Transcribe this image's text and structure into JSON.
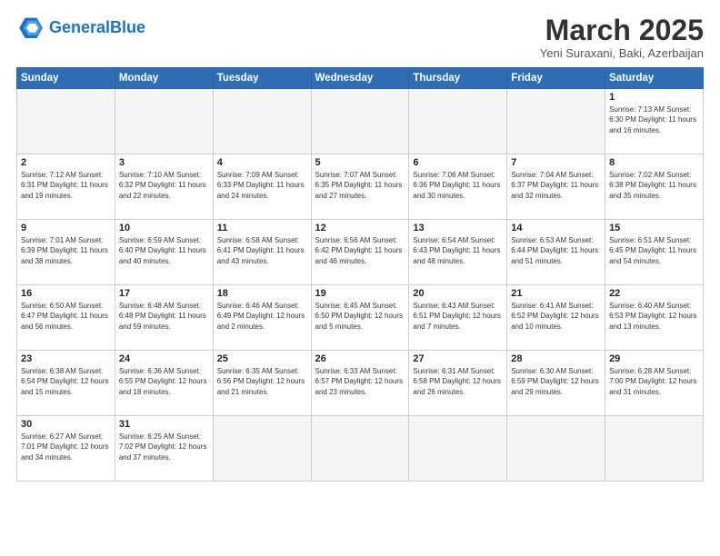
{
  "logo": {
    "text_general": "General",
    "text_blue": "Blue"
  },
  "title": "March 2025",
  "location": "Yeni Suraxani, Baki, Azerbaijan",
  "days_of_week": [
    "Sunday",
    "Monday",
    "Tuesday",
    "Wednesday",
    "Thursday",
    "Friday",
    "Saturday"
  ],
  "weeks": [
    [
      {
        "day": "",
        "info": ""
      },
      {
        "day": "",
        "info": ""
      },
      {
        "day": "",
        "info": ""
      },
      {
        "day": "",
        "info": ""
      },
      {
        "day": "",
        "info": ""
      },
      {
        "day": "",
        "info": ""
      },
      {
        "day": "1",
        "info": "Sunrise: 7:13 AM\nSunset: 6:30 PM\nDaylight: 11 hours and 16 minutes."
      }
    ],
    [
      {
        "day": "2",
        "info": "Sunrise: 7:12 AM\nSunset: 6:31 PM\nDaylight: 11 hours and 19 minutes."
      },
      {
        "day": "3",
        "info": "Sunrise: 7:10 AM\nSunset: 6:32 PM\nDaylight: 11 hours and 22 minutes."
      },
      {
        "day": "4",
        "info": "Sunrise: 7:09 AM\nSunset: 6:33 PM\nDaylight: 11 hours and 24 minutes."
      },
      {
        "day": "5",
        "info": "Sunrise: 7:07 AM\nSunset: 6:35 PM\nDaylight: 11 hours and 27 minutes."
      },
      {
        "day": "6",
        "info": "Sunrise: 7:06 AM\nSunset: 6:36 PM\nDaylight: 11 hours and 30 minutes."
      },
      {
        "day": "7",
        "info": "Sunrise: 7:04 AM\nSunset: 6:37 PM\nDaylight: 11 hours and 32 minutes."
      },
      {
        "day": "8",
        "info": "Sunrise: 7:02 AM\nSunset: 6:38 PM\nDaylight: 11 hours and 35 minutes."
      }
    ],
    [
      {
        "day": "9",
        "info": "Sunrise: 7:01 AM\nSunset: 6:39 PM\nDaylight: 11 hours and 38 minutes."
      },
      {
        "day": "10",
        "info": "Sunrise: 6:59 AM\nSunset: 6:40 PM\nDaylight: 11 hours and 40 minutes."
      },
      {
        "day": "11",
        "info": "Sunrise: 6:58 AM\nSunset: 6:41 PM\nDaylight: 11 hours and 43 minutes."
      },
      {
        "day": "12",
        "info": "Sunrise: 6:56 AM\nSunset: 6:42 PM\nDaylight: 11 hours and 46 minutes."
      },
      {
        "day": "13",
        "info": "Sunrise: 6:54 AM\nSunset: 6:43 PM\nDaylight: 11 hours and 48 minutes."
      },
      {
        "day": "14",
        "info": "Sunrise: 6:53 AM\nSunset: 6:44 PM\nDaylight: 11 hours and 51 minutes."
      },
      {
        "day": "15",
        "info": "Sunrise: 6:51 AM\nSunset: 6:45 PM\nDaylight: 11 hours and 54 minutes."
      }
    ],
    [
      {
        "day": "16",
        "info": "Sunrise: 6:50 AM\nSunset: 6:47 PM\nDaylight: 11 hours and 56 minutes."
      },
      {
        "day": "17",
        "info": "Sunrise: 6:48 AM\nSunset: 6:48 PM\nDaylight: 11 hours and 59 minutes."
      },
      {
        "day": "18",
        "info": "Sunrise: 6:46 AM\nSunset: 6:49 PM\nDaylight: 12 hours and 2 minutes."
      },
      {
        "day": "19",
        "info": "Sunrise: 6:45 AM\nSunset: 6:50 PM\nDaylight: 12 hours and 5 minutes."
      },
      {
        "day": "20",
        "info": "Sunrise: 6:43 AM\nSunset: 6:51 PM\nDaylight: 12 hours and 7 minutes."
      },
      {
        "day": "21",
        "info": "Sunrise: 6:41 AM\nSunset: 6:52 PM\nDaylight: 12 hours and 10 minutes."
      },
      {
        "day": "22",
        "info": "Sunrise: 6:40 AM\nSunset: 6:53 PM\nDaylight: 12 hours and 13 minutes."
      }
    ],
    [
      {
        "day": "23",
        "info": "Sunrise: 6:38 AM\nSunset: 6:54 PM\nDaylight: 12 hours and 15 minutes."
      },
      {
        "day": "24",
        "info": "Sunrise: 6:36 AM\nSunset: 6:55 PM\nDaylight: 12 hours and 18 minutes."
      },
      {
        "day": "25",
        "info": "Sunrise: 6:35 AM\nSunset: 6:56 PM\nDaylight: 12 hours and 21 minutes."
      },
      {
        "day": "26",
        "info": "Sunrise: 6:33 AM\nSunset: 6:57 PM\nDaylight: 12 hours and 23 minutes."
      },
      {
        "day": "27",
        "info": "Sunrise: 6:31 AM\nSunset: 6:58 PM\nDaylight: 12 hours and 26 minutes."
      },
      {
        "day": "28",
        "info": "Sunrise: 6:30 AM\nSunset: 6:59 PM\nDaylight: 12 hours and 29 minutes."
      },
      {
        "day": "29",
        "info": "Sunrise: 6:28 AM\nSunset: 7:00 PM\nDaylight: 12 hours and 31 minutes."
      }
    ],
    [
      {
        "day": "30",
        "info": "Sunrise: 6:27 AM\nSunset: 7:01 PM\nDaylight: 12 hours and 34 minutes."
      },
      {
        "day": "31",
        "info": "Sunrise: 6:25 AM\nSunset: 7:02 PM\nDaylight: 12 hours and 37 minutes."
      },
      {
        "day": "",
        "info": ""
      },
      {
        "day": "",
        "info": ""
      },
      {
        "day": "",
        "info": ""
      },
      {
        "day": "",
        "info": ""
      },
      {
        "day": "",
        "info": ""
      }
    ]
  ]
}
